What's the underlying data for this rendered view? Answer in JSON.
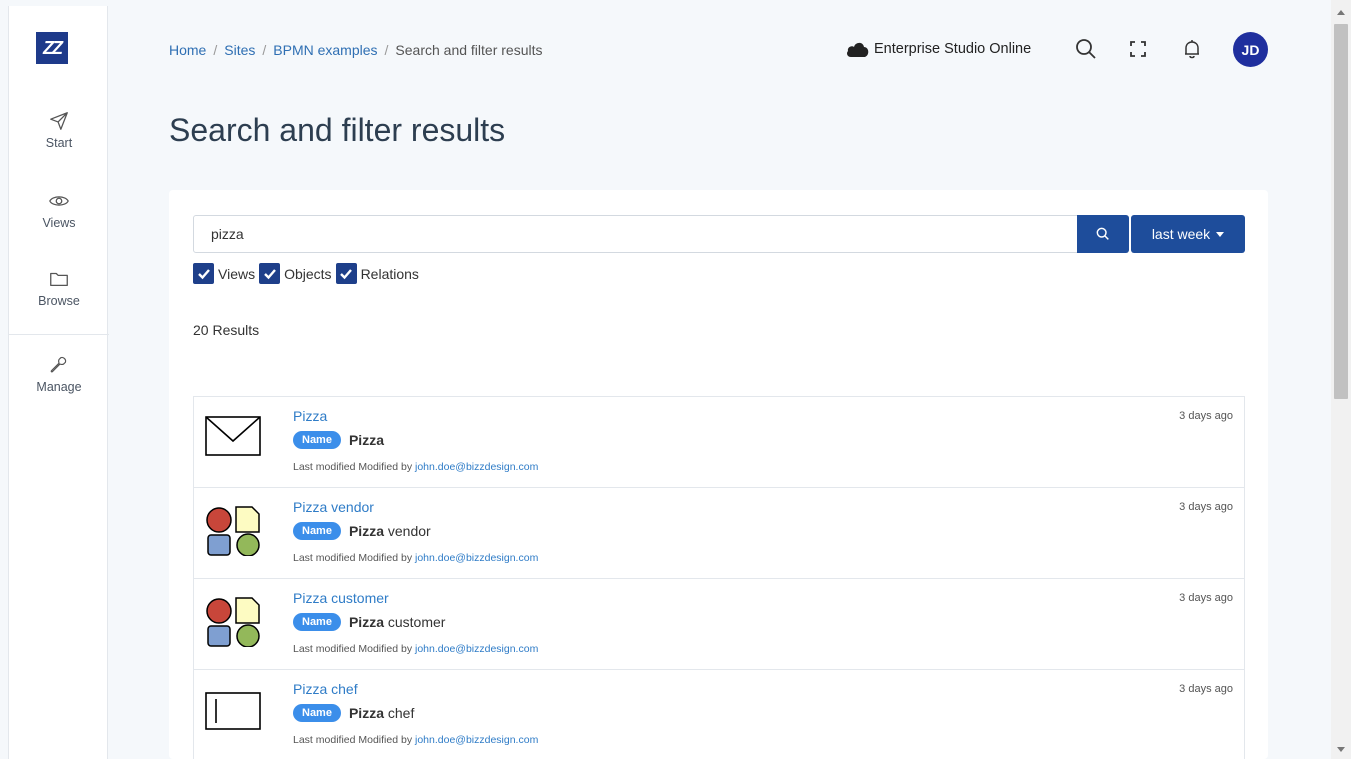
{
  "sidebar": {
    "logo": "ZZ",
    "items": [
      {
        "label": "Start"
      },
      {
        "label": "Views"
      },
      {
        "label": "Browse"
      },
      {
        "label": "Manage"
      }
    ]
  },
  "breadcrumb": {
    "items": [
      "Home",
      "Sites",
      "BPMN examples"
    ],
    "current": "Search and filter results",
    "separator": "/"
  },
  "header": {
    "environment": "Enterprise Studio Online",
    "avatar_initials": "JD"
  },
  "page": {
    "title": "Search and filter results"
  },
  "search": {
    "value": "pizza",
    "date_filter": "last week"
  },
  "filters": [
    {
      "label": "Views",
      "checked": true
    },
    {
      "label": "Objects",
      "checked": true
    },
    {
      "label": "Relations",
      "checked": true
    }
  ],
  "results_count": "20 Results",
  "results": [
    {
      "title": "Pizza",
      "badge": "Name",
      "match_bold": "Pizza",
      "match_rest": "",
      "modified_prefix": "Last modified Modified by",
      "modified_by": "john.doe@bizzdesign.com",
      "time": "3 days ago",
      "icon": "message-event-icon"
    },
    {
      "title": "Pizza vendor",
      "badge": "Name",
      "match_bold": "Pizza",
      "match_rest": " vendor",
      "modified_prefix": "Last modified Modified by",
      "modified_by": "john.doe@bizzdesign.com",
      "time": "3 days ago",
      "icon": "shapes-icon"
    },
    {
      "title": "Pizza customer",
      "badge": "Name",
      "match_bold": "Pizza",
      "match_rest": " customer",
      "modified_prefix": "Last modified Modified by",
      "modified_by": "john.doe@bizzdesign.com",
      "time": "3 days ago",
      "icon": "shapes-icon"
    },
    {
      "title": "Pizza chef",
      "badge": "Name",
      "match_bold": "Pizza",
      "match_rest": " chef",
      "modified_prefix": "Last modified Modified by",
      "modified_by": "john.doe@bizzdesign.com",
      "time": "3 days ago",
      "icon": "lane-icon"
    }
  ],
  "colors": {
    "brand": "#1e3a8a",
    "button": "#1e4d9b",
    "link": "#2f7cc7",
    "badge": "#3b8eea",
    "avatar": "#1f2f9e"
  }
}
